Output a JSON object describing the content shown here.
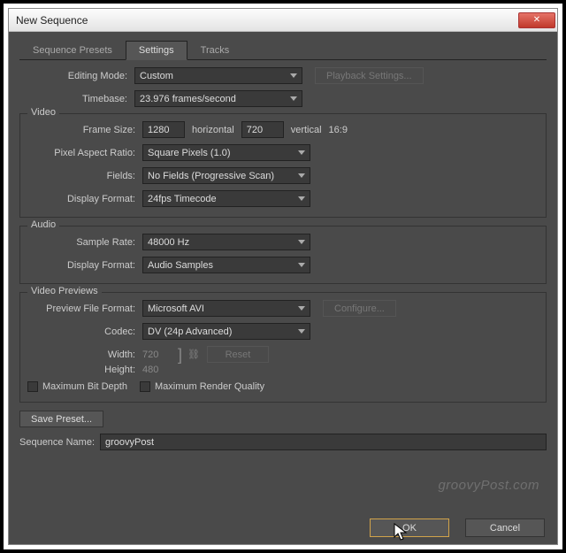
{
  "window": {
    "title": "New Sequence"
  },
  "tabs": {
    "presets": "Sequence Presets",
    "settings": "Settings",
    "tracks": "Tracks"
  },
  "top": {
    "editing_mode_label": "Editing Mode:",
    "editing_mode_value": "Custom",
    "playback_btn": "Playback Settings...",
    "timebase_label": "Timebase:",
    "timebase_value": "23.976 frames/second"
  },
  "video": {
    "title": "Video",
    "frame_size_label": "Frame Size:",
    "frame_w": "1280",
    "horiz": "horizontal",
    "frame_h": "720",
    "vert": "vertical",
    "aspect": "16:9",
    "par_label": "Pixel Aspect Ratio:",
    "par_value": "Square Pixels (1.0)",
    "fields_label": "Fields:",
    "fields_value": "No Fields (Progressive Scan)",
    "disp_label": "Display Format:",
    "disp_value": "24fps Timecode"
  },
  "audio": {
    "title": "Audio",
    "rate_label": "Sample Rate:",
    "rate_value": "48000 Hz",
    "disp_label": "Display Format:",
    "disp_value": "Audio Samples"
  },
  "previews": {
    "title": "Video Previews",
    "format_label": "Preview File Format:",
    "format_value": "Microsoft AVI",
    "configure_btn": "Configure...",
    "codec_label": "Codec:",
    "codec_value": "DV (24p Advanced)",
    "width_label": "Width:",
    "width_value": "720",
    "height_label": "Height:",
    "height_value": "480",
    "reset_btn": "Reset",
    "max_bit": "Maximum Bit Depth",
    "max_render": "Maximum Render Quality"
  },
  "save_preset_btn": "Save Preset...",
  "seq_name_label": "Sequence Name:",
  "seq_name_value": "groovyPost",
  "ok_btn": "OK",
  "cancel_btn": "Cancel",
  "watermark": "groovyPost.com"
}
